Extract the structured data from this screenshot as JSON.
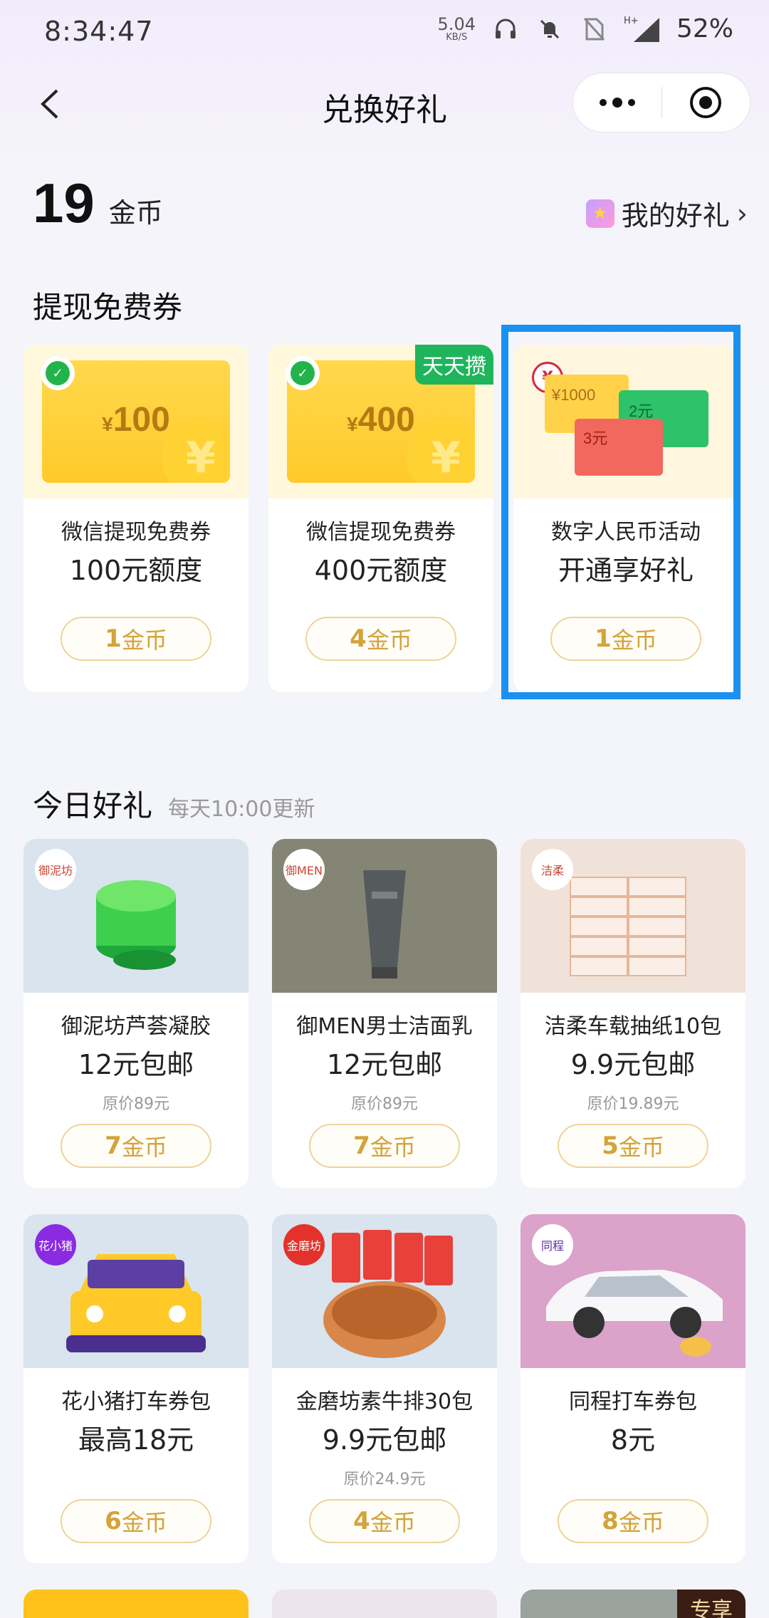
{
  "status": {
    "time": "8:34:47",
    "net_speed": "5.04",
    "net_unit": "KB/S",
    "network": "H+",
    "battery": "52%"
  },
  "nav": {
    "title": "兑换好礼"
  },
  "header": {
    "coins": "19",
    "coin_unit": "金币",
    "my_gifts": "我的好礼"
  },
  "section_withdraw": {
    "title": "提现免费券",
    "cards": [
      {
        "amount": "100",
        "currency": "¥",
        "name": "微信提现免费券",
        "price": "100元额度",
        "cost_num": "1",
        "cost_unit": "金币"
      },
      {
        "amount": "400",
        "currency": "¥",
        "tag": "天天攒",
        "name": "微信提现免费券",
        "price": "400元额度",
        "cost_num": "4",
        "cost_unit": "金币"
      },
      {
        "name": "数字人民币活动",
        "price": "开通享好礼",
        "cost_num": "1",
        "cost_unit": "金币",
        "mini": {
          "a": "¥1000",
          "b": "2元",
          "c": "3元"
        }
      }
    ]
  },
  "section_today": {
    "title": "今日好礼",
    "subtitle": "每天10:00更新",
    "cards": [
      {
        "brand": "御泥坊",
        "name": "御泥坊芦荟凝胶",
        "price": "12元包邮",
        "orig": "原价89元",
        "cost_num": "7",
        "cost_unit": "金币"
      },
      {
        "brand": "御MEN",
        "name": "御MEN男士洁面乳",
        "price": "12元包邮",
        "orig": "原价89元",
        "cost_num": "7",
        "cost_unit": "金币"
      },
      {
        "brand": "洁柔",
        "name": "洁柔车载抽纸10包",
        "price": "9.9元包邮",
        "orig": "原价19.89元",
        "cost_num": "5",
        "cost_unit": "金币"
      },
      {
        "brand": "花小猪",
        "name": "花小猪打车券包",
        "price": "最高18元",
        "orig": "",
        "cost_num": "6",
        "cost_unit": "金币"
      },
      {
        "brand": "金磨坊",
        "name": "金磨坊素牛排30包",
        "price": "9.9元包邮",
        "orig": "原价24.9元",
        "cost_num": "4",
        "cost_unit": "金币"
      },
      {
        "brand": "同程",
        "name": "同程打车券包",
        "price": "8元",
        "orig": "",
        "cost_num": "8",
        "cost_unit": "金币"
      }
    ]
  },
  "peek": {
    "tag": "专享"
  },
  "colors": {
    "accent_gold": "#d4a33a",
    "selection_blue": "#1a91f0",
    "wechat_green": "#22b44a"
  }
}
